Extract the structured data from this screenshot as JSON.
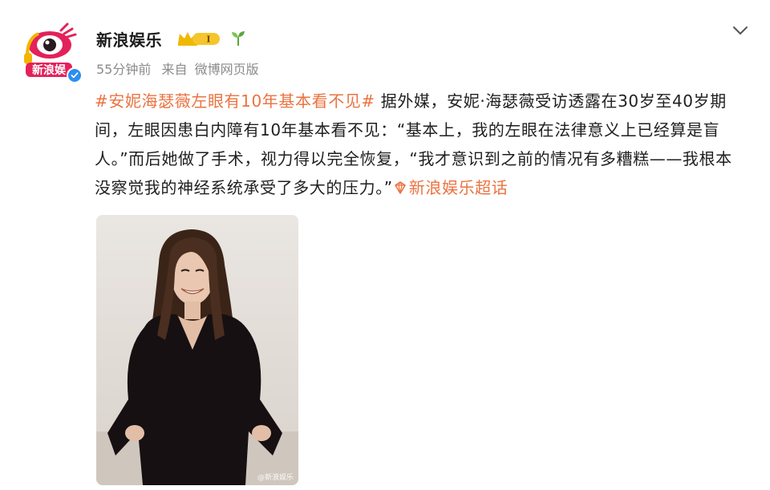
{
  "post": {
    "username": "新浪娱乐",
    "badge_level": "I",
    "meta": {
      "time": "55分钟前",
      "source_prefix": "来自",
      "source": "微博网页版"
    },
    "hashtag": "#安妮海瑟薇左眼有10年基本看不见#",
    "text": "据外媒，安妮·海瑟薇受访透露在30岁至40岁期间，左眼因患白内障有10年基本看不见：“基本上，我的左眼在法律意义上已经算是盲人。”而后她做了手术，视力得以完全恢复，“我才意识到之前的情况有多糟糕——我根本没察觉我的神经系统承受了多大的压力。”",
    "topic_link": "新浪娱乐超话",
    "image_watermark": "@新浪娱乐"
  },
  "icons": {
    "avatar": "sina-eye-logo",
    "verified": "verified-badge-icon",
    "crown": "crown-level-badge-icon",
    "sprout": "sprout-icon",
    "chevron": "chevron-down-icon",
    "topic": "super-topic-icon"
  },
  "colors": {
    "accent": "#eb7340",
    "meta": "#8b8b8b",
    "verified": "#2b8ff0"
  }
}
